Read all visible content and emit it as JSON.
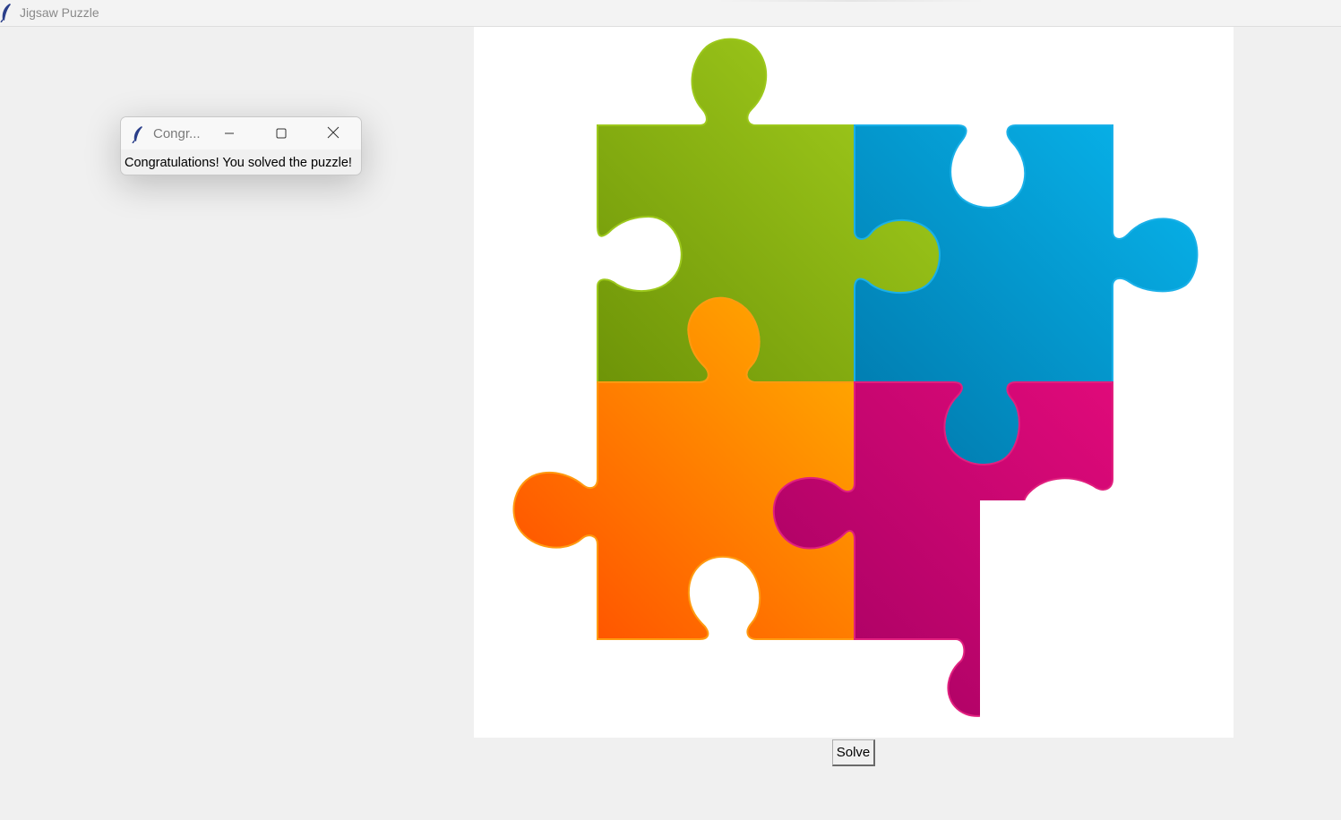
{
  "window": {
    "title": "Jigsaw Puzzle",
    "icon": "feather-icon"
  },
  "dialog": {
    "title": "Congr...",
    "message": "Congratulations! You solved the puzzle!",
    "icons": [
      "feather-icon",
      "minimize-icon",
      "maximize-icon",
      "close-icon"
    ]
  },
  "puzzle": {
    "pieces": [
      {
        "name": "green",
        "color": "#8cb814"
      },
      {
        "name": "blue",
        "color": "#0a9ad8"
      },
      {
        "name": "orange",
        "color": "#ff8a00"
      },
      {
        "name": "magenta",
        "color": "#c6086e"
      }
    ]
  },
  "controls": {
    "solve_label": "Solve"
  }
}
